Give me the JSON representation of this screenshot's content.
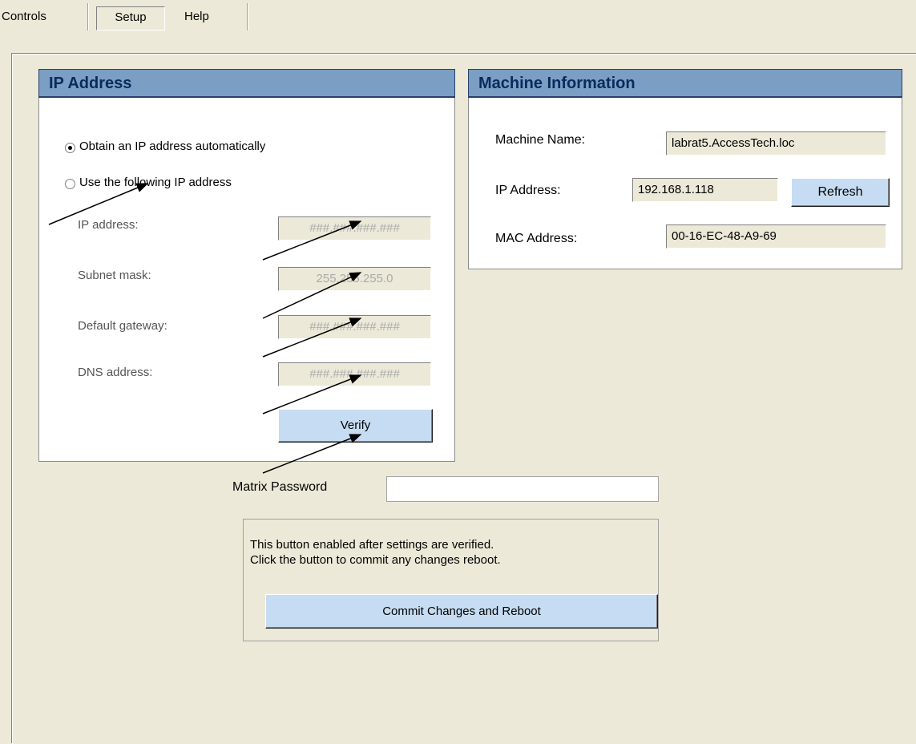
{
  "menu": {
    "controls": "Controls",
    "setup": "Setup",
    "help": "Help"
  },
  "ip_panel": {
    "title": "IP Address",
    "radio_auto": "Obtain an IP address automatically",
    "radio_manual": "Use the following IP address",
    "selected": "auto",
    "ip_label": "IP address:",
    "ip_value": "###.###.###.###",
    "subnet_label": "Subnet mask:",
    "subnet_value": "255.255.255.0",
    "gateway_label": "Default gateway:",
    "gateway_value": "###.###.###.###",
    "dns_label": "DNS address:",
    "dns_value": "###.###.###.###",
    "verify_label": "Verify"
  },
  "machine_panel": {
    "title": "Machine Information",
    "name_label": "Machine Name:",
    "name_value": "labrat5.AccessTech.loc",
    "ip_label": "IP Address:",
    "ip_value": "192.168.1.118",
    "refresh_label": "Refresh",
    "mac_label": "MAC Address:",
    "mac_value": "00-16-EC-48-A9-69"
  },
  "password": {
    "label": "Matrix Password",
    "value": ""
  },
  "commit": {
    "note_line1": "This button enabled after settings are verified.",
    "note_line2": "Click the button to commit any changes  reboot.",
    "button_label": "Commit Changes and Reboot"
  },
  "colors": {
    "window_bg": "#ece9d8",
    "panel_header": "#7a9ec4",
    "button_face": "#c6dcf2"
  }
}
